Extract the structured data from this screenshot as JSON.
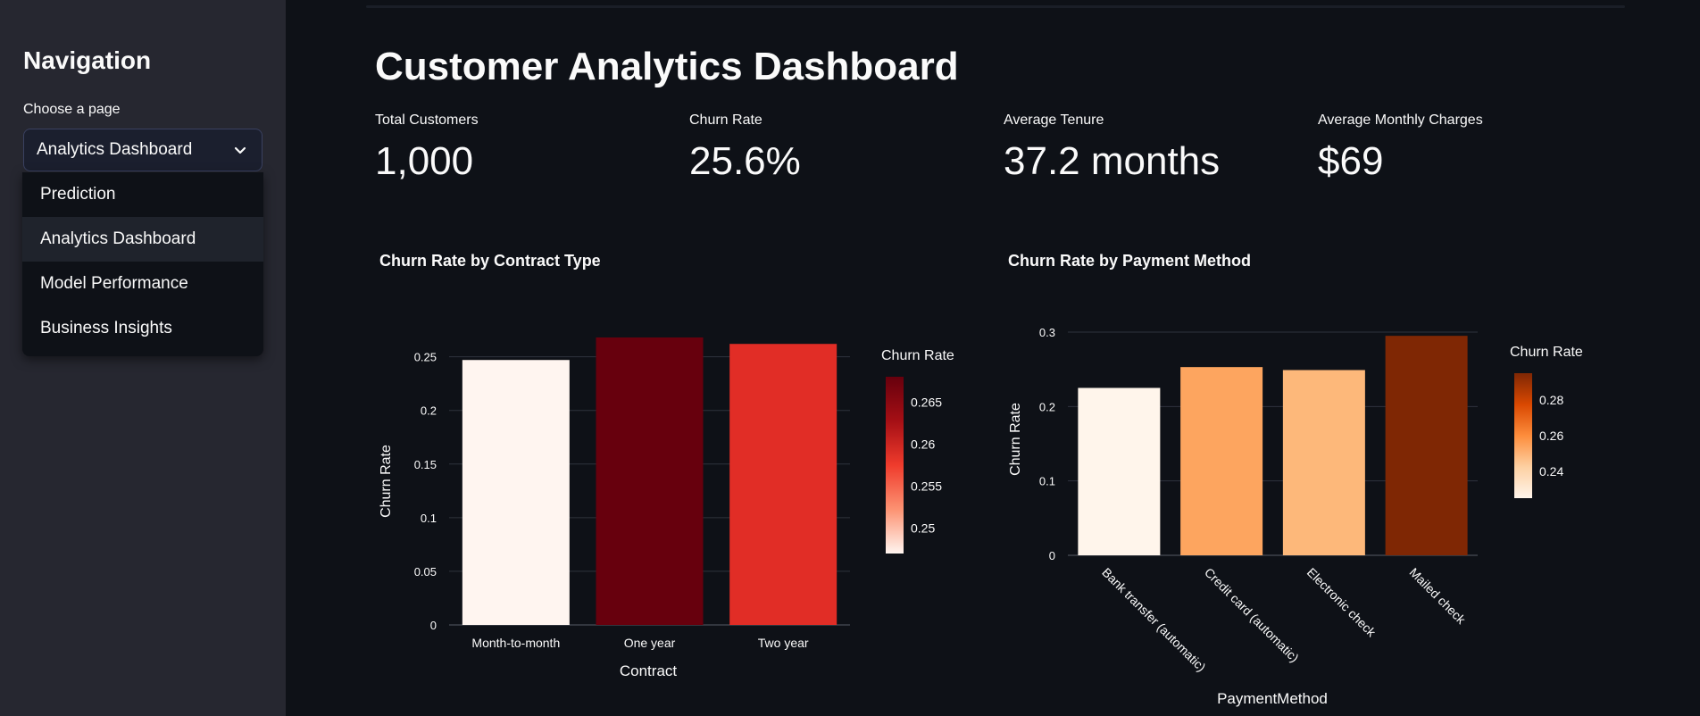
{
  "sidebar": {
    "title": "Navigation",
    "choose_label": "Choose a page",
    "selected": "Analytics Dashboard",
    "options": [
      "Prediction",
      "Analytics Dashboard",
      "Model Performance",
      "Business Insights"
    ]
  },
  "main": {
    "title": "Customer Analytics Dashboard",
    "metrics": [
      {
        "label": "Total Customers",
        "value": "1,000"
      },
      {
        "label": "Churn Rate",
        "value": "25.6%"
      },
      {
        "label": "Average Tenure",
        "value": "37.2 months"
      },
      {
        "label": "Average Monthly Charges",
        "value": "$69"
      }
    ]
  },
  "chart_data": [
    {
      "type": "bar",
      "title": "Churn Rate by Contract Type",
      "xlabel": "Contract",
      "ylabel": "Churn Rate",
      "categories": [
        "Month-to-month",
        "One year",
        "Two year"
      ],
      "values": [
        0.247,
        0.268,
        0.262
      ],
      "ylim": [
        0,
        0.268
      ],
      "yticks": [
        0,
        0.05,
        0.1,
        0.15,
        0.2,
        0.25
      ],
      "ytick_labels": [
        "0",
        "0.05",
        "0.1",
        "0.15",
        "0.2",
        "0.25"
      ],
      "colorbar": {
        "title": "Churn Rate",
        "ticks": [
          0.25,
          0.255,
          0.26,
          0.265
        ],
        "tick_labels": [
          "0.25",
          "0.255",
          "0.26",
          "0.265"
        ],
        "range": [
          0.247,
          0.268
        ],
        "colors": [
          "#fff5f0",
          "#fc9272",
          "#ef3b2c",
          "#a50f15",
          "#67000d"
        ]
      },
      "bar_colors": [
        "#fff5f0",
        "#67000d",
        "#e12d26"
      ],
      "grid": true
    },
    {
      "type": "bar",
      "title": "Churn Rate by Payment Method",
      "xlabel": "PaymentMethod",
      "ylabel": "Churn Rate",
      "categories": [
        "Bank transfer (automatic)",
        "Credit card (automatic)",
        "Electronic check",
        "Mailed check"
      ],
      "values": [
        0.225,
        0.253,
        0.249,
        0.295
      ],
      "ylim": [
        0,
        0.3
      ],
      "yticks": [
        0,
        0.1,
        0.2,
        0.3
      ],
      "ytick_labels": [
        "0",
        "0.1",
        "0.2",
        "0.3"
      ],
      "colorbar": {
        "title": "Churn Rate",
        "ticks": [
          0.24,
          0.26,
          0.28
        ],
        "tick_labels": [
          "0.24",
          "0.26",
          "0.28"
        ],
        "range": [
          0.225,
          0.295
        ],
        "colors": [
          "#fff5eb",
          "#fdd0a2",
          "#fd8d3c",
          "#d94801",
          "#7f2704"
        ]
      },
      "bar_colors": [
        "#fff5eb",
        "#fda55f",
        "#fdb87a",
        "#7f2704"
      ],
      "grid": true
    }
  ]
}
